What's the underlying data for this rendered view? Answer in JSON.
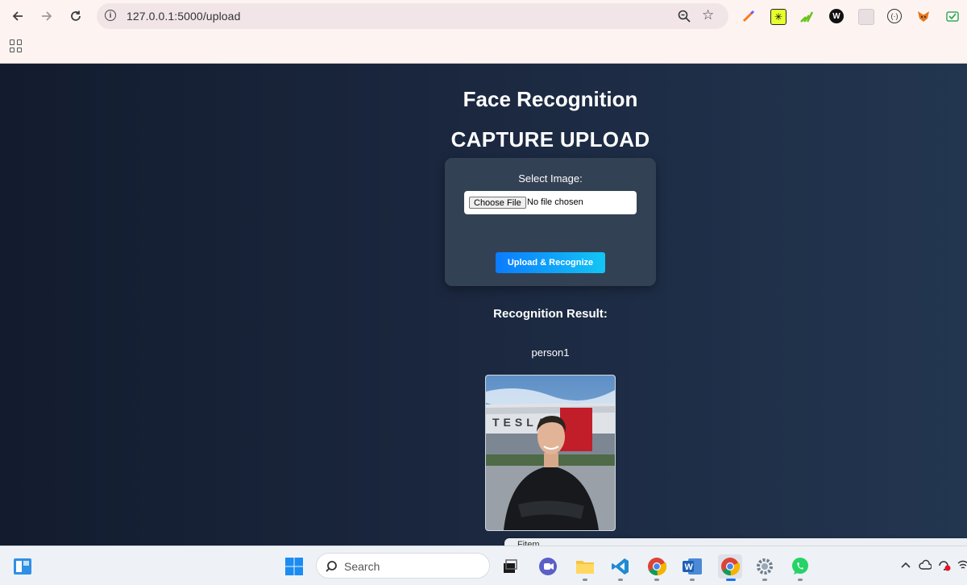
{
  "browser": {
    "url": "127.0.0.1:5000/upload",
    "extensions": [
      "paint-brush-icon",
      "sparkle-extension-icon",
      "growth-extension-icon",
      "w-extension-icon",
      "puzzle-extension-icon",
      "bracket-extension-icon",
      "fox-wallet-icon",
      "mail-check-icon"
    ]
  },
  "page": {
    "title": "Face Recognition",
    "subtitle": "CAPTURE UPLOAD",
    "form": {
      "label": "Select Image:",
      "choose_file": "Choose File",
      "no_file": "No file chosen",
      "submit": "Upload & Recognize"
    },
    "result_heading": "Recognition Result:",
    "result_name": "person1",
    "photo_text": "TESLA"
  },
  "taskbar": {
    "search_label": "Search",
    "tooltip": "Fitem"
  },
  "colors": {
    "page_bg_left": "#131c2e",
    "page_bg_right": "#233650",
    "card": "#334155",
    "button_start": "#0b7cff",
    "button_end": "#12c6f4"
  }
}
